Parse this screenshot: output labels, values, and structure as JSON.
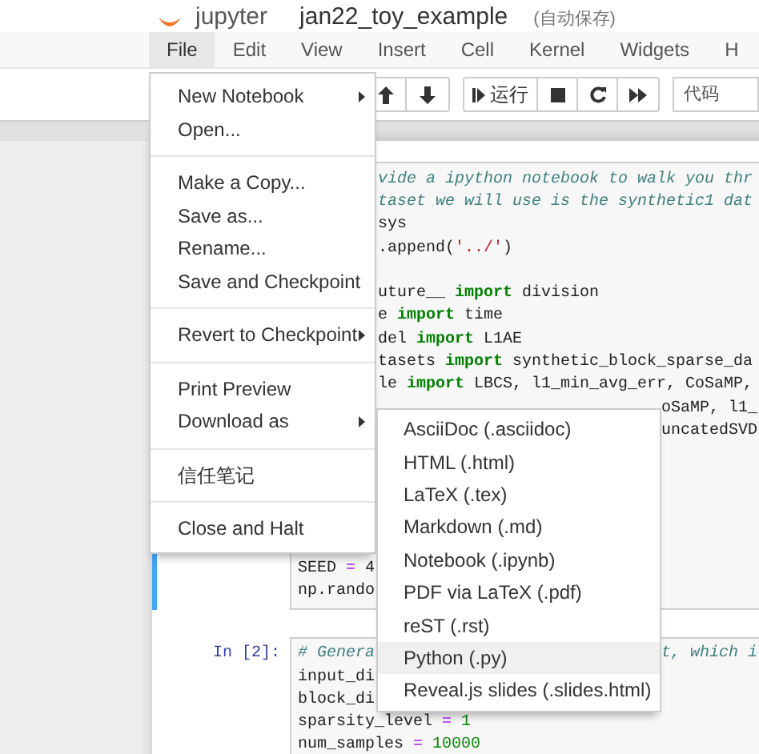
{
  "header": {
    "logo_text": "jupyter",
    "notebook_name": "jan22_toy_example",
    "save_status": "(自动保存)"
  },
  "menubar": [
    {
      "label": "File",
      "selected": true
    },
    {
      "label": "Edit",
      "selected": false
    },
    {
      "label": "View",
      "selected": false
    },
    {
      "label": "Insert",
      "selected": false
    },
    {
      "label": "Cell",
      "selected": false
    },
    {
      "label": "Kernel",
      "selected": false
    },
    {
      "label": "Widgets",
      "selected": false
    },
    {
      "label": "H",
      "selected": false
    }
  ],
  "toolbar": {
    "run_label": "运行",
    "cell_type": "代码"
  },
  "cells": [
    {
      "selected": true,
      "lines": [
        {
          "kind": "after_menu",
          "segments": [
            {
              "kind": "comment",
              "text": "vide a ipython notebook to walk you thr"
            }
          ]
        },
        {
          "kind": "after_menu",
          "segments": [
            {
              "kind": "comment",
              "text": "taset we will use is the synthetic1 dat"
            }
          ]
        },
        {
          "kind": "after_menu",
          "segments": [
            {
              "kind": "plain",
              "text": "sys"
            }
          ]
        },
        {
          "kind": "after_menu",
          "segments": [
            {
              "kind": "plain",
              "text": ".append("
            },
            {
              "kind": "string",
              "text": "'../'"
            },
            {
              "kind": "plain",
              "text": ")"
            }
          ]
        },
        {
          "kind": "covered"
        },
        {
          "kind": "after_menu",
          "segments": [
            {
              "kind": "plain",
              "text": "uture__ "
            },
            {
              "kind": "keyword",
              "text": "import"
            },
            {
              "kind": "plain",
              "text": " division"
            }
          ]
        },
        {
          "kind": "after_menu",
          "segments": [
            {
              "kind": "plain",
              "text": "e "
            },
            {
              "kind": "keyword",
              "text": "import"
            },
            {
              "kind": "plain",
              "text": " time"
            }
          ]
        },
        {
          "kind": "after_menu",
          "segments": [
            {
              "kind": "plain",
              "text": "del "
            },
            {
              "kind": "keyword",
              "text": "import"
            },
            {
              "kind": "plain",
              "text": " L1AE"
            }
          ]
        },
        {
          "kind": "after_menu",
          "segments": [
            {
              "kind": "plain",
              "text": "tasets "
            },
            {
              "kind": "keyword",
              "text": "import"
            },
            {
              "kind": "plain",
              "text": " synthetic_block_sparse_da"
            }
          ]
        },
        {
          "kind": "after_menu",
          "segments": [
            {
              "kind": "plain",
              "text": "le "
            },
            {
              "kind": "keyword",
              "text": "import"
            },
            {
              "kind": "plain",
              "text": " LBCS, l1_min_avg_err, CoSaMP,"
            }
          ]
        },
        {
          "kind": "after_submenu",
          "segments": [
            {
              "kind": "plain",
              "text": "oSaMP, l1_"
            }
          ]
        },
        {
          "kind": "after_submenu",
          "segments": [
            {
              "kind": "plain",
              "text": "uncatedSVD"
            }
          ]
        },
        {
          "kind": "covered"
        },
        {
          "kind": "covered"
        },
        {
          "kind": "covered"
        },
        {
          "kind": "covered"
        },
        {
          "kind": "covered"
        },
        {
          "kind": "full",
          "segments": [
            {
              "kind": "plain",
              "text": "SEED "
            },
            {
              "kind": "operator",
              "text": "="
            },
            {
              "kind": "plain",
              "text": " 4"
            }
          ]
        },
        {
          "kind": "full",
          "segments": [
            {
              "kind": "plain",
              "text": "np.rando"
            }
          ]
        }
      ]
    },
    {
      "prompt": "In [2]:",
      "selected": false,
      "lines": [
        {
          "kind": "full",
          "segments": [
            {
              "kind": "comment",
              "text": "# Genera"
            }
          ],
          "right": [
            {
              "kind": "comment",
              "text": "t, which i"
            }
          ]
        },
        {
          "kind": "full",
          "segments": [
            {
              "kind": "plain",
              "text": "input_di"
            }
          ]
        },
        {
          "kind": "full",
          "segments": [
            {
              "kind": "plain",
              "text": "block_di"
            }
          ]
        },
        {
          "kind": "full",
          "segments": [
            {
              "kind": "plain",
              "text": "sparsity_level "
            },
            {
              "kind": "operator",
              "text": "="
            },
            {
              "kind": "number",
              "text": " 1"
            }
          ]
        },
        {
          "kind": "full",
          "segments": [
            {
              "kind": "plain",
              "text": "num_samples "
            },
            {
              "kind": "operator",
              "text": "="
            },
            {
              "kind": "number",
              "text": " 10000"
            }
          ]
        }
      ]
    }
  ],
  "file_menu": [
    {
      "kind": "item",
      "label": "New Notebook",
      "submenu": true
    },
    {
      "kind": "item",
      "label": "Open...",
      "submenu": false
    },
    {
      "kind": "divider"
    },
    {
      "kind": "item",
      "label": "Make a Copy...",
      "submenu": false
    },
    {
      "kind": "item",
      "label": "Save as...",
      "submenu": false
    },
    {
      "kind": "item",
      "label": "Rename...",
      "submenu": false
    },
    {
      "kind": "item",
      "label": "Save and Checkpoint",
      "submenu": false
    },
    {
      "kind": "divider"
    },
    {
      "kind": "item",
      "label": "Revert to Checkpoint",
      "submenu": true
    },
    {
      "kind": "divider"
    },
    {
      "kind": "item",
      "label": "Print Preview",
      "submenu": false
    },
    {
      "kind": "item",
      "label": "Download as",
      "submenu": true
    },
    {
      "kind": "divider"
    },
    {
      "kind": "item",
      "label": "信任笔记",
      "submenu": false
    },
    {
      "kind": "divider"
    },
    {
      "kind": "item",
      "label": "Close and Halt",
      "submenu": false
    }
  ],
  "download_menu": [
    {
      "label": "AsciiDoc (.asciidoc)",
      "selected": false
    },
    {
      "label": "HTML (.html)",
      "selected": false
    },
    {
      "label": "LaTeX (.tex)",
      "selected": false
    },
    {
      "label": "Markdown (.md)",
      "selected": false
    },
    {
      "label": "Notebook (.ipynb)",
      "selected": false
    },
    {
      "label": "PDF via LaTeX (.pdf)",
      "selected": false
    },
    {
      "label": "reST (.rst)",
      "selected": false
    },
    {
      "label": "Python (.py)",
      "selected": true
    },
    {
      "label": "Reveal.js slides (.slides.html)",
      "selected": false
    }
  ]
}
